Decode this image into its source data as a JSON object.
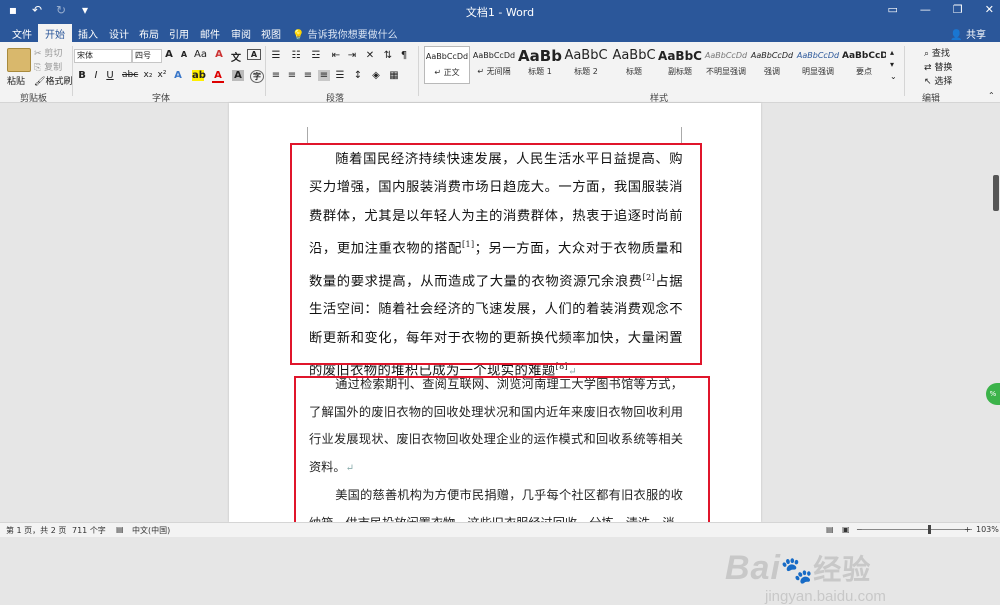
{
  "titlebar": {
    "title": "文档1 - Word",
    "save_icon": "save-icon",
    "undo_icon": "undo-icon",
    "redo_icon": "redo-icon"
  },
  "menu": {
    "tabs": [
      "文件",
      "开始",
      "插入",
      "设计",
      "布局",
      "引用",
      "邮件",
      "审阅",
      "视图"
    ],
    "active_tab": "开始",
    "tell_me": "告诉我你想要做什么",
    "share": "共享"
  },
  "ribbon": {
    "clipboard": {
      "paste": "粘贴",
      "cut": "剪切",
      "copy": "复制",
      "format_painter": "格式刷",
      "label": "剪贴板"
    },
    "font": {
      "name": "宋体",
      "size": "四号",
      "label": "字体"
    },
    "paragraph": {
      "label": "段落"
    },
    "styles": {
      "label": "样式",
      "items": [
        {
          "preview": "AaBbCcDd",
          "name": "↵ 正文"
        },
        {
          "preview": "AaBbCcDd",
          "name": "↵ 无间隔"
        },
        {
          "preview": "AaBb",
          "name": "标题 1"
        },
        {
          "preview": "AaBbC",
          "name": "标题 2"
        },
        {
          "preview": "AaBbC",
          "name": "标题"
        },
        {
          "preview": "AaBbC",
          "name": "副标题"
        },
        {
          "preview": "AaBbCcDd",
          "name": "不明显强调"
        },
        {
          "preview": "AaBbCcDd",
          "name": "强调"
        },
        {
          "preview": "AaBbCcDd",
          "name": "明显强调"
        },
        {
          "preview": "AaBbCcD",
          "name": "要点"
        }
      ]
    },
    "editing": {
      "find": "查找",
      "replace": "替换",
      "select": "选择",
      "label": "编辑"
    }
  },
  "document": {
    "para1": "随着国民经济持续快速发展，人民生活水平日益提高、购买力增强，国内服装消费市场日趋庞大。一方面，我国服装消费群体，尤其是以年轻人为主的消费群体，热衷于追逐时尚前沿，更加注重衣物的搭配",
    "ref1": "[1]",
    "para1b": "；另一方面，大众对于衣物质量和数量的要求提高，从而造成了大量的衣物资源冗余浪费",
    "ref2": "[2]",
    "para1c": "占据生活空间：随着社会经济的飞速发展，人们的着装消费观念不断更新和变化，每年对于衣物的更新换代频率加快，大量闲置的废旧衣物的堆积已成为一个现实的难题",
    "ref3": "[8]",
    "para2": "通过检索期刊、查阅互联网、浏览河南理工大学图书馆等方式，了解国外的废旧衣物的回收处理状况和国内近年来废旧衣物回收利用行业发展现状、废旧衣物回收处理企业的运作模式和回收系统等相关资料。",
    "para3": "美国的慈善机构为方便市民捐赠，几乎每个社区都有旧衣服的收纳箱，供市民投放闲置衣物，这些旧衣服经过回收、分拣、清洗、消"
  },
  "status": {
    "page": "第 1 页，共 2 页",
    "words": "711 个字",
    "language": "中文(中国)",
    "zoom": "103%"
  },
  "watermark": {
    "main": "Bai",
    "main2": "经验",
    "sub": "jingyan.baidu.com"
  },
  "badge": "%",
  "colors": {
    "accent": "#2b579a",
    "annotation": "#e0152b"
  }
}
